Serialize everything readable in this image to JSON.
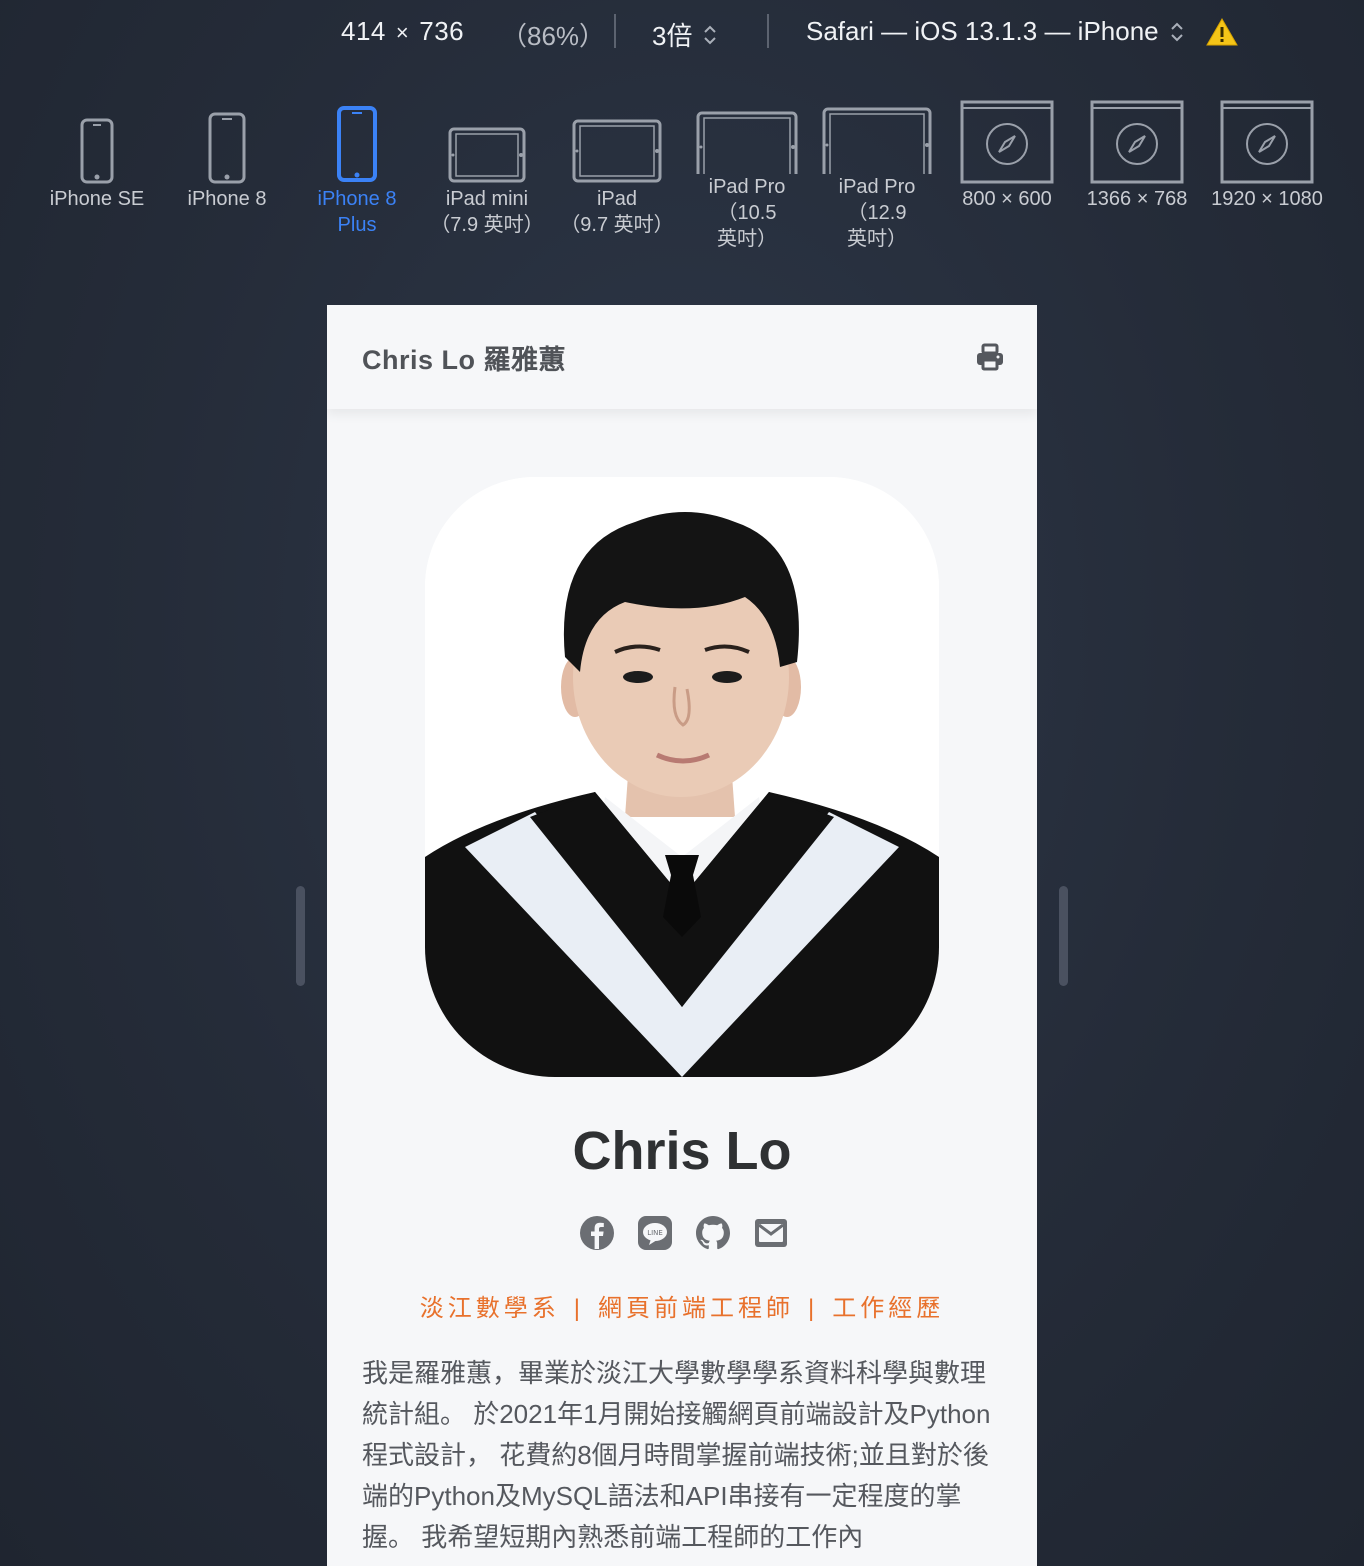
{
  "toolbar": {
    "width": "414",
    "height": "736",
    "times": "×",
    "percent": "（86%）",
    "scale": "3倍",
    "browser": "Safari — iOS 13.1.3 — iPhone",
    "warning_icon": "warning-icon"
  },
  "devices": [
    {
      "label": "iPhone SE",
      "icon": "phone-small-icon"
    },
    {
      "label": "iPhone 8",
      "icon": "phone-icon"
    },
    {
      "label": "iPhone 8\nPlus",
      "icon": "phone-large-icon",
      "active": true
    },
    {
      "label": "iPad mini\n（7.9 英吋）",
      "icon": "tablet-icon"
    },
    {
      "label": "iPad\n（9.7 英吋）",
      "icon": "tablet-icon"
    },
    {
      "label": "iPad Pro\n（10.5\n英吋）",
      "icon": "tablet-large-icon"
    },
    {
      "label": "iPad Pro\n（12.9\n英吋）",
      "icon": "tablet-large-icon"
    },
    {
      "label": "800 × 600",
      "icon": "browser-window-icon"
    },
    {
      "label": "1366 × 768",
      "icon": "browser-window-icon"
    },
    {
      "label": "1920 × 1080",
      "icon": "browser-window-icon"
    }
  ],
  "page": {
    "brand": "Chris Lo 羅雅蕙",
    "name": "Chris Lo",
    "tags": [
      "淡江數學系",
      "網頁前端工程師",
      "工作經歷"
    ],
    "tag_separator": "|",
    "bio": "我是羅雅蕙，畢業於淡江大學數學學系資料科學與數理統計組。 於2021年1月開始接觸網頁前端設計及Python程式設計， 花費約8個月時間掌握前端技術;並且對於後端的Python及MySQL語法和API串接有一定程度的掌握。 我希望短期內熟悉前端工程師的工作內",
    "social_icons": [
      "facebook-icon",
      "line-icon",
      "github-icon",
      "email-icon"
    ]
  },
  "colors": {
    "accent_blue": "#3b82f6",
    "tag_orange": "#e8712c",
    "page_bg": "#f6f7f9"
  }
}
